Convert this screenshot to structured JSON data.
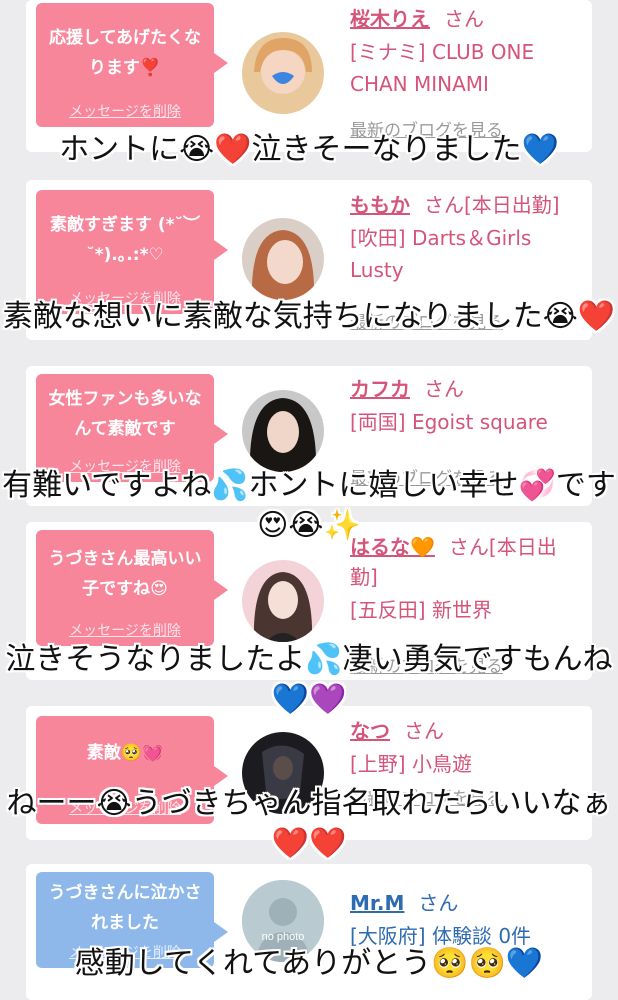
{
  "cards": [
    {
      "message": "応援してあげたくなります❣️",
      "delete_label": "メッセージを削除",
      "name": "桜木りえ",
      "honorific": "さん",
      "status": "",
      "shop": "[ミナミ] CLUB ONE CHAN MINAMI",
      "blog_label": "最新のブログを見る"
    },
    {
      "message": "素敵すぎます (*˘︶˘*).｡.:*♡",
      "delete_label": "メッセージを削除",
      "name": "ももか",
      "honorific": "さん",
      "status": "[本日出勤]",
      "shop": "[吹田] Darts＆Girls Lusty",
      "blog_label": "最新のブログを見る"
    },
    {
      "message": "女性ファンも多いなんて素敵です",
      "delete_label": "メッセージを削除",
      "name": "カフカ",
      "honorific": "さん",
      "status": "",
      "shop": "[両国] Egoist square",
      "blog_label": "最新のブログを見る"
    },
    {
      "message": "うづきさん最高いい子ですね😍",
      "delete_label": "メッセージを削除",
      "name": "はるな🧡",
      "honorific": "さん",
      "status": "[本日出勤]",
      "shop": "[五反田] 新世界",
      "blog_label": "最新のブログを見る"
    },
    {
      "message": "素敵🥺💓",
      "delete_label": "メッセージを削除",
      "name": "なつ",
      "honorific": "さん",
      "status": "",
      "shop": "[上野] 小鳥遊",
      "blog_label": "最新のブログを見る"
    },
    {
      "message": "うづきさんに泣かされました",
      "delete_label": "メッセージを削除",
      "name": "Mr.M",
      "honorific": "さん",
      "status": "",
      "shop": "[大阪府] 体験談 0件",
      "blog_label": "",
      "avatar_text": "no photo"
    }
  ],
  "captions": [
    "ホントに😭❤️泣きそーなりました💙",
    "素敵な想いに素敵な気持ちになりました😭❤️",
    "有難いですよね💦ホントに嬉しい幸せ💞です😍😭✨",
    "泣きそうなりましたよ💦凄い勇気ですもんね💙💜",
    "ねーー😭うづきちゃん指名取れたらいいなぁ❤️❤️",
    "感動してくれてありがとう🥺🥺💙"
  ],
  "colors": {
    "pink_bubble": "#f7869b",
    "blue_bubble": "#8eb8ea",
    "name_pink": "#d5547a",
    "name_blue": "#2e6bb0"
  }
}
